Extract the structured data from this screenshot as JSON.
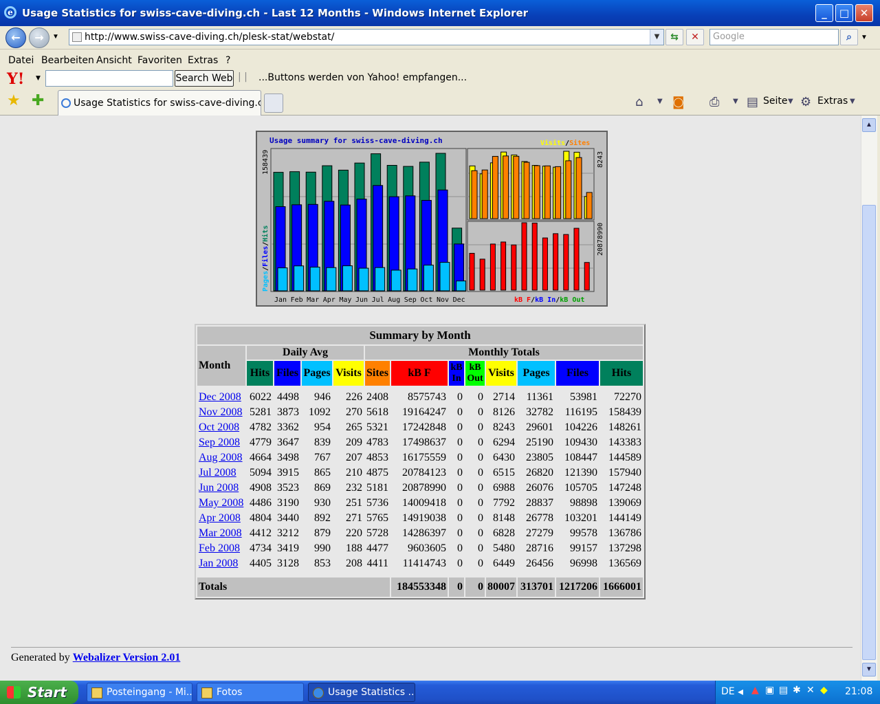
{
  "window": {
    "title": "Usage Statistics for swiss-cave-diving.ch - Last 12 Months - Windows Internet Explorer",
    "min_glyph": "_",
    "max_glyph": "□",
    "close_glyph": "✕"
  },
  "address_bar": {
    "url": "http://www.swiss-cave-diving.ch/plesk-stat/webstat/",
    "search_placeholder": "Google"
  },
  "menu": [
    "Datei",
    "Bearbeiten",
    "Ansicht",
    "Favoriten",
    "Extras",
    "?"
  ],
  "yahoo_bar": {
    "logo": "Y!",
    "search_button": "Search Web",
    "message": "...Buttons werden von Yahoo! empfangen..."
  },
  "tabs": {
    "active_label": "Usage Statistics for swiss-cave-diving.ch - ..."
  },
  "toolbar": {
    "page_label": "Seite",
    "tools_label": "Extras"
  },
  "chart_data": {
    "type": "bar",
    "title": "Usage summary for swiss-cave-diving.ch",
    "categories": [
      "Jan",
      "Feb",
      "Mar",
      "Apr",
      "May",
      "Jun",
      "Jul",
      "Aug",
      "Sep",
      "Oct",
      "Nov",
      "Dec"
    ],
    "left_scale_label": "158439",
    "right_top_scale_label": "8243",
    "right_bottom_scale_label": "20878990",
    "left_legend": [
      "Pages",
      "/",
      "Files",
      "/",
      "Hits"
    ],
    "top_right_legend": [
      "Visits",
      "/",
      "Sites"
    ],
    "bottom_right_legend": [
      "kB F",
      "/",
      "kB In",
      "/",
      "kB Out"
    ],
    "series": [
      {
        "name": "Hits",
        "values": [
          136569,
          137298,
          136786,
          144149,
          139069,
          147248,
          157940,
          144589,
          143383,
          148261,
          158439,
          72270
        ]
      },
      {
        "name": "Files",
        "values": [
          96998,
          99157,
          99578,
          103201,
          98898,
          105705,
          121390,
          108447,
          109430,
          104226,
          116195,
          53981
        ]
      },
      {
        "name": "Pages",
        "values": [
          26456,
          28716,
          27279,
          26778,
          28837,
          26076,
          26820,
          23805,
          25190,
          29601,
          32782,
          11361
        ]
      },
      {
        "name": "Visits",
        "values": [
          6449,
          5480,
          6828,
          8148,
          7792,
          6988,
          6515,
          6430,
          6294,
          8243,
          8126,
          2714
        ]
      },
      {
        "name": "Sites",
        "values": [
          4411,
          4477,
          5728,
          5765,
          5736,
          5181,
          4875,
          4853,
          4783,
          5321,
          5618,
          2408
        ]
      },
      {
        "name": "kB F",
        "values": [
          11414743,
          9603605,
          14286397,
          14919038,
          14009418,
          20878990,
          20784123,
          16175559,
          17498637,
          17242848,
          19164247,
          8575743
        ]
      }
    ],
    "colors": {
      "hits": "#00805c",
      "files": "#0000ff",
      "pages": "#00c0ff",
      "visits": "#ffff00",
      "sites": "#ff8000",
      "kbf": "#ff0000",
      "kbin": "#0000ff",
      "kbout": "#00c000"
    }
  },
  "summary": {
    "title": "Summary by Month",
    "month_header": "Month",
    "daily_avg_header": "Daily Avg",
    "monthly_totals_header": "Monthly Totals",
    "columns": [
      "Hits",
      "Files",
      "Pages",
      "Visits",
      "Sites",
      "kB F",
      "kB In",
      "kB Out",
      "Visits",
      "Pages",
      "Files",
      "Hits"
    ],
    "rows": [
      {
        "month": "Dec 2008",
        "v": [
          "6022",
          "4498",
          "946",
          "226",
          "2408",
          "8575743",
          "0",
          "0",
          "2714",
          "11361",
          "53981",
          "72270"
        ]
      },
      {
        "month": "Nov 2008",
        "v": [
          "5281",
          "3873",
          "1092",
          "270",
          "5618",
          "19164247",
          "0",
          "0",
          "8126",
          "32782",
          "116195",
          "158439"
        ]
      },
      {
        "month": "Oct 2008",
        "v": [
          "4782",
          "3362",
          "954",
          "265",
          "5321",
          "17242848",
          "0",
          "0",
          "8243",
          "29601",
          "104226",
          "148261"
        ]
      },
      {
        "month": "Sep 2008",
        "v": [
          "4779",
          "3647",
          "839",
          "209",
          "4783",
          "17498637",
          "0",
          "0",
          "6294",
          "25190",
          "109430",
          "143383"
        ]
      },
      {
        "month": "Aug 2008",
        "v": [
          "4664",
          "3498",
          "767",
          "207",
          "4853",
          "16175559",
          "0",
          "0",
          "6430",
          "23805",
          "108447",
          "144589"
        ]
      },
      {
        "month": "Jul 2008",
        "v": [
          "5094",
          "3915",
          "865",
          "210",
          "4875",
          "20784123",
          "0",
          "0",
          "6515",
          "26820",
          "121390",
          "157940"
        ]
      },
      {
        "month": "Jun 2008",
        "v": [
          "4908",
          "3523",
          "869",
          "232",
          "5181",
          "20878990",
          "0",
          "0",
          "6988",
          "26076",
          "105705",
          "147248"
        ]
      },
      {
        "month": "May 2008",
        "v": [
          "4486",
          "3190",
          "930",
          "251",
          "5736",
          "14009418",
          "0",
          "0",
          "7792",
          "28837",
          "98898",
          "139069"
        ]
      },
      {
        "month": "Apr 2008",
        "v": [
          "4804",
          "3440",
          "892",
          "271",
          "5765",
          "14919038",
          "0",
          "0",
          "8148",
          "26778",
          "103201",
          "144149"
        ]
      },
      {
        "month": "Mar 2008",
        "v": [
          "4412",
          "3212",
          "879",
          "220",
          "5728",
          "14286397",
          "0",
          "0",
          "6828",
          "27279",
          "99578",
          "136786"
        ]
      },
      {
        "month": "Feb 2008",
        "v": [
          "4734",
          "3419",
          "990",
          "188",
          "4477",
          "9603605",
          "0",
          "0",
          "5480",
          "28716",
          "99157",
          "137298"
        ]
      },
      {
        "month": "Jan 2008",
        "v": [
          "4405",
          "3128",
          "853",
          "208",
          "4411",
          "11414743",
          "0",
          "0",
          "6449",
          "26456",
          "96998",
          "136569"
        ]
      }
    ],
    "totals_label": "Totals",
    "totals": [
      "184553348",
      "0",
      "0",
      "80007",
      "313701",
      "1217206",
      "1666001"
    ]
  },
  "footer": {
    "prefix": "Generated by",
    "link": "Webalizer Version 2.01"
  },
  "taskbar": {
    "start": "Start",
    "tasks": [
      "Posteingang - Mi...",
      "Fotos",
      "Usage Statistics ..."
    ],
    "lang": "DE",
    "clock": "21:08"
  }
}
